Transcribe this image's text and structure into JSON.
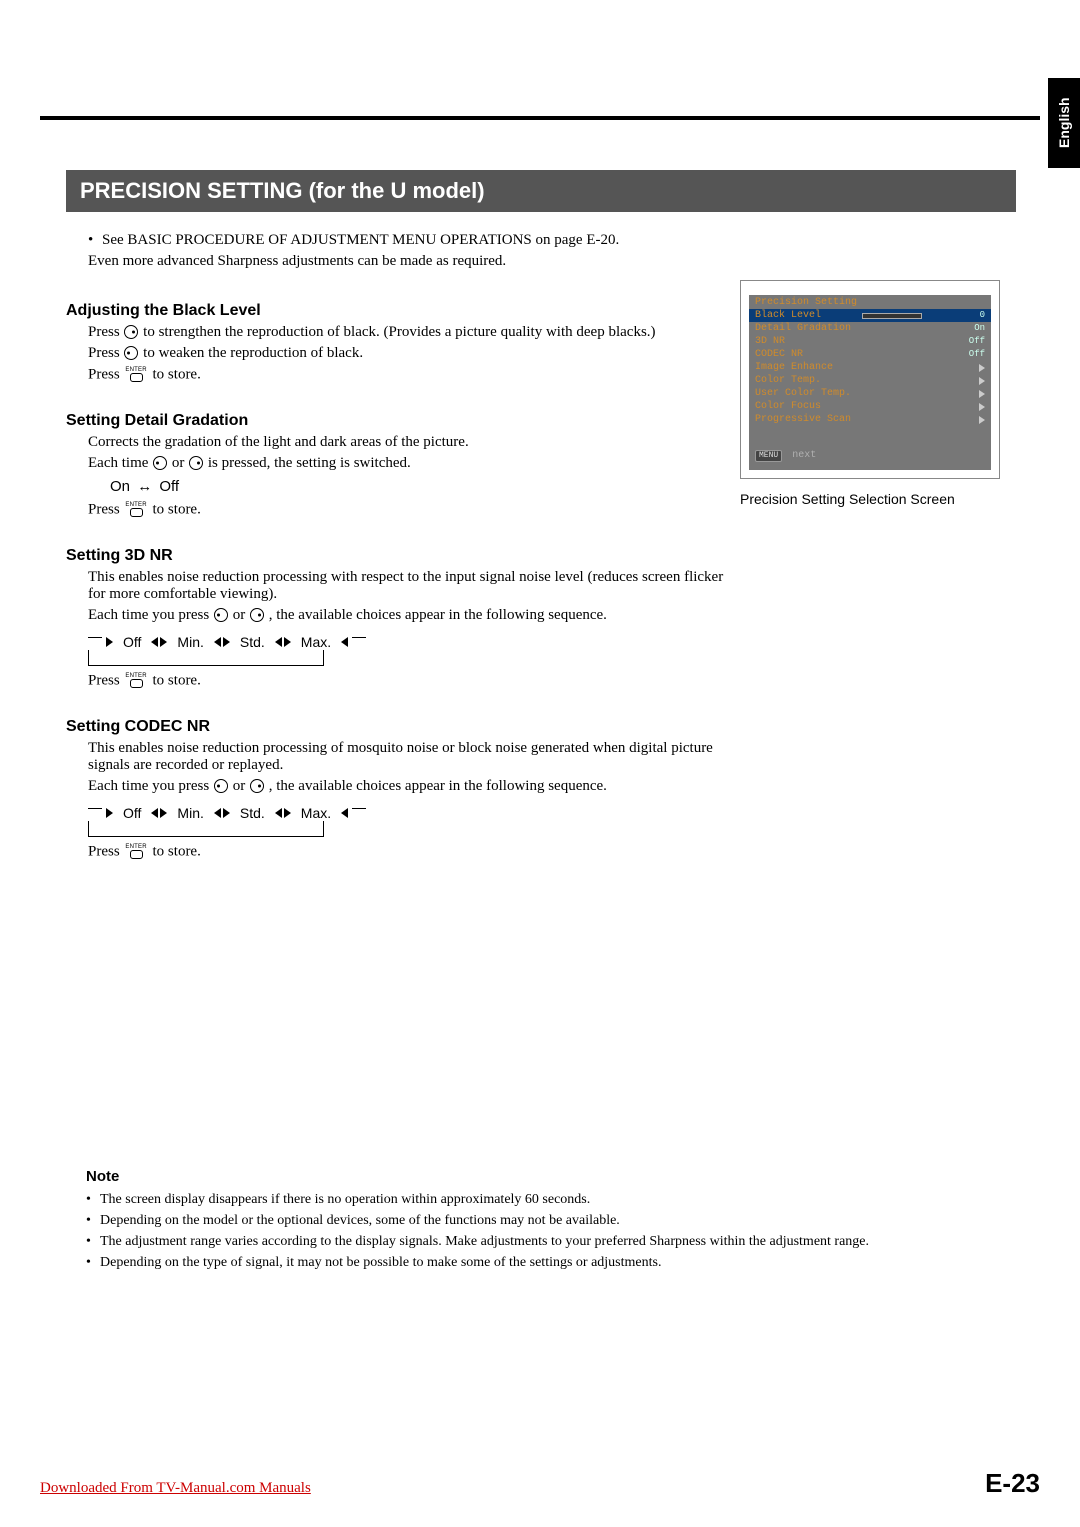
{
  "language_tab": "English",
  "main_title": "PRECISION SETTING (for the U model)",
  "intro_bullet": "See BASIC PROCEDURE OF ADJUSTMENT MENU OPERATIONS on page E-20.",
  "intro_line": "Even more advanced Sharpness adjustments can be made as required.",
  "black_level": {
    "heading": "Adjusting the Black Level",
    "line1_pre": "Press ",
    "line1_post": " to strengthen the reproduction of black. (Provides a picture quality with deep blacks.)",
    "line2_pre": "Press ",
    "line2_post": " to weaken the reproduction of black.",
    "store_pre": "Press ",
    "store_post": " to store."
  },
  "detail": {
    "heading": "Setting Detail Gradation",
    "desc": "Corrects the gradation of the light and dark areas of the picture.",
    "each_pre": "Each time ",
    "each_mid": " or ",
    "each_post": " is pressed, the setting is switched.",
    "onoff_on": "On",
    "onoff_off": "Off",
    "store_pre": "Press ",
    "store_post": " to store."
  },
  "nr3d": {
    "heading": "Setting 3D NR",
    "desc": "This enables noise reduction processing with respect to the input signal noise level (reduces screen flicker for more comfortable viewing).",
    "each_pre": "Each time you press ",
    "each_mid": " or ",
    "each_post": ", the available choices appear in the following sequence.",
    "seq_off": "Off",
    "seq_min": "Min.",
    "seq_std": "Std.",
    "seq_max": "Max.",
    "store_pre": "Press ",
    "store_post": " to store."
  },
  "codec": {
    "heading": "Setting CODEC NR",
    "desc": "This enables noise reduction processing of mosquito noise or block noise generated when digital picture signals are recorded or replayed.",
    "each_pre": "Each time you press ",
    "each_mid": " or ",
    "each_post": ", the available choices appear in the following sequence.",
    "seq_off": "Off",
    "seq_min": "Min.",
    "seq_std": "Std.",
    "seq_max": "Max.",
    "store_pre": "Press ",
    "store_post": " to store."
  },
  "osd": {
    "title": "Precision Setting",
    "rows": {
      "r0": {
        "label": "Black Level",
        "val": "0"
      },
      "r1": {
        "label": "Detail Gradation",
        "val": "On"
      },
      "r2": {
        "label": "3D NR",
        "val": "Off"
      },
      "r3": {
        "label": "CODEC NR",
        "val": "Off"
      },
      "r4": {
        "label": "Image Enhance"
      },
      "r5": {
        "label": "Color Temp."
      },
      "r6": {
        "label": "User Color Temp."
      },
      "r7": {
        "label": "Color Focus"
      },
      "r8": {
        "label": "Progressive Scan"
      }
    },
    "footer_badge": "MENU",
    "footer_text": "next",
    "caption": "Precision Setting Selection Screen"
  },
  "notes": {
    "heading": "Note",
    "n1": "The screen display disappears if there is no operation within approximately 60 seconds.",
    "n2": "Depending on the model or the optional devices, some of the functions may not be available.",
    "n3": "The adjustment range varies according to the display signals. Make adjustments to your preferred Sharpness within the adjustment range.",
    "n4": "Depending on the type of signal, it may not be possible to make some of the settings or adjustments."
  },
  "footer": {
    "download": "Downloaded From TV-Manual.com Manuals",
    "page": "E-23"
  },
  "enter_label": "ENTER"
}
